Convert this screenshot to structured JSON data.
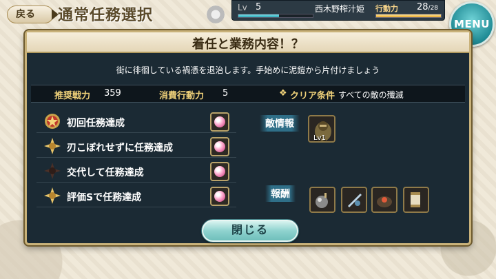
{
  "topbar": {
    "back_label": "戻る",
    "screen_title": "通常任務選択",
    "menu_label": "MENU"
  },
  "status": {
    "lv_label": "Lv",
    "lv_value": "5",
    "player_name": "西木野榨汁姫",
    "stamina_label": "行動力",
    "stamina_current": "28",
    "stamina_max": "/28",
    "stamina_fraction": 1.0,
    "exp_fraction": 0.55
  },
  "dialog": {
    "title": "着任と業務内容！？",
    "description": "街に徘徊している禍憑を退治します。手始めに泥鎧から片付けましょう",
    "stats": {
      "power_label": "推奨戦力",
      "power_value": "359",
      "cost_label": "消費行動力",
      "cost_value": "5",
      "clear_label": "クリア条件",
      "clear_value": "すべての敵の殲滅"
    },
    "missions": [
      {
        "text": "初回任務達成",
        "medal": "red-medal-icon"
      },
      {
        "text": "刃こぼれせずに任務達成",
        "medal": "gold-medal-icon"
      },
      {
        "text": "交代して任務達成",
        "medal": "dark-medal-icon"
      },
      {
        "text": "評価Sで任務達成",
        "medal": "gold-medal-icon"
      }
    ],
    "enemy_label": "敵情報",
    "enemy_level": "Lv1",
    "reward_label": "報酬",
    "close_label": "閉じる"
  }
}
